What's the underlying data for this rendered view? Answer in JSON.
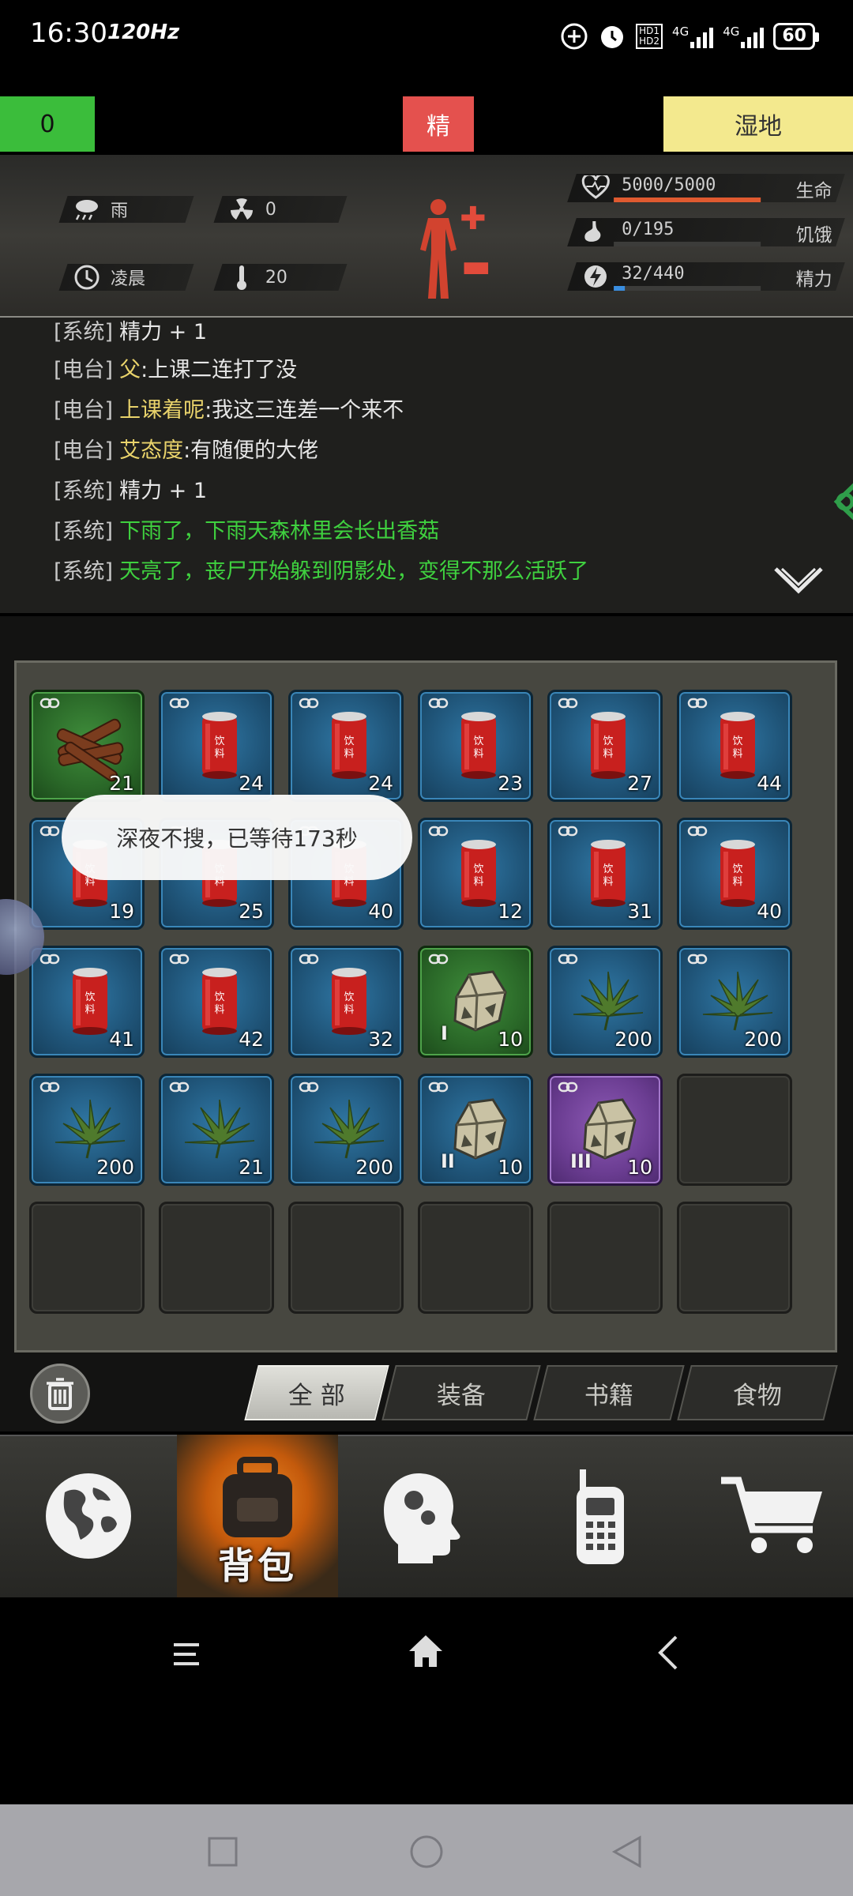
{
  "status_bar": {
    "time": "16:30",
    "refresh": "120Hz",
    "net1": "4G",
    "net2": "4G",
    "battery": "60",
    "hd_badge": "HD1 HD2"
  },
  "markers": {
    "left_value": "0",
    "middle": "精",
    "right": "湿地"
  },
  "hud": {
    "weather": {
      "icon": "rain-cloud-icon",
      "label": "雨"
    },
    "radiation": {
      "icon": "radiation-icon",
      "value": "0"
    },
    "time_of_day": {
      "icon": "clock-icon",
      "label": "凌晨"
    },
    "temperature": {
      "icon": "thermometer-icon",
      "value": "20"
    },
    "stats": [
      {
        "label": "生命",
        "value": "5000/5000",
        "fraction": 1.0,
        "color": "#e05a30",
        "icon": "heart-icon"
      },
      {
        "label": "饥饿",
        "value": "0/195",
        "fraction": 0.0,
        "color": "#888888",
        "icon": "stomach-icon"
      },
      {
        "label": "精力",
        "value": "32/440",
        "fraction": 0.073,
        "color": "#3a8ee0",
        "icon": "lightning-icon"
      }
    ]
  },
  "log": [
    {
      "tag": "[系统]",
      "speaker": "",
      "text": "精力 + 1",
      "color": "white"
    },
    {
      "tag": "[电台]",
      "speaker": "父",
      "text": ":上课二连打了没",
      "color": "yellow"
    },
    {
      "tag": "[电台]",
      "speaker": "上课着呢",
      "text": ":我这三连差一个来不",
      "color": "yellow"
    },
    {
      "tag": "[电台]",
      "speaker": "艾态度",
      "text": ":有随便的大佬",
      "color": "yellow"
    },
    {
      "tag": "[系统]",
      "speaker": "",
      "text": "精力 + 1",
      "color": "white"
    },
    {
      "tag": "[系统]",
      "speaker": "",
      "text": "下雨了，下雨天森林里会长出香菇",
      "color": "green"
    },
    {
      "tag": "[系统]",
      "speaker": "",
      "text": "天亮了，丧尸开始躲到阴影处，变得不那么活跃了",
      "color": "green"
    }
  ],
  "toast": "深夜不搜，已等待173秒",
  "inventory": [
    [
      {
        "item": "wood",
        "rarity": "green",
        "count": "21"
      },
      {
        "item": "drink",
        "rarity": "blue",
        "count": "24"
      },
      {
        "item": "drink",
        "rarity": "blue",
        "count": "24"
      },
      {
        "item": "drink",
        "rarity": "blue",
        "count": "23"
      },
      {
        "item": "drink",
        "rarity": "blue",
        "count": "27"
      },
      {
        "item": "drink",
        "rarity": "blue",
        "count": "44"
      }
    ],
    [
      {
        "item": "drink",
        "rarity": "blue",
        "count": "19"
      },
      {
        "item": "drink",
        "rarity": "blue",
        "count": "25"
      },
      {
        "item": "drink",
        "rarity": "blue",
        "count": "40"
      },
      {
        "item": "drink",
        "rarity": "blue",
        "count": "12"
      },
      {
        "item": "drink",
        "rarity": "blue",
        "count": "31"
      },
      {
        "item": "drink",
        "rarity": "blue",
        "count": "40"
      }
    ],
    [
      {
        "item": "drink",
        "rarity": "blue",
        "count": "41"
      },
      {
        "item": "drink",
        "rarity": "blue",
        "count": "42"
      },
      {
        "item": "drink",
        "rarity": "blue",
        "count": "32"
      },
      {
        "item": "ore",
        "rarity": "green",
        "count": "10",
        "tier": "I"
      },
      {
        "item": "herb",
        "rarity": "blue",
        "count": "200"
      },
      {
        "item": "herb",
        "rarity": "blue",
        "count": "200"
      }
    ],
    [
      {
        "item": "herb",
        "rarity": "blue",
        "count": "200"
      },
      {
        "item": "herb",
        "rarity": "blue",
        "count": "21"
      },
      {
        "item": "herb",
        "rarity": "blue",
        "count": "200"
      },
      {
        "item": "ore",
        "rarity": "blue",
        "count": "10",
        "tier": "II"
      },
      {
        "item": "ore",
        "rarity": "purple",
        "count": "10",
        "tier": "III"
      },
      {
        "item": "empty",
        "rarity": "empty",
        "count": ""
      }
    ],
    [
      {
        "item": "empty",
        "rarity": "empty",
        "count": ""
      },
      {
        "item": "empty",
        "rarity": "empty",
        "count": ""
      },
      {
        "item": "empty",
        "rarity": "empty",
        "count": ""
      },
      {
        "item": "empty",
        "rarity": "empty",
        "count": ""
      },
      {
        "item": "empty",
        "rarity": "empty",
        "count": ""
      },
      {
        "item": "empty",
        "rarity": "empty",
        "count": ""
      }
    ]
  ],
  "drink_label": "饮料",
  "tabs": [
    {
      "label": "全 部",
      "active": true
    },
    {
      "label": "装备",
      "active": false
    },
    {
      "label": "书籍",
      "active": false
    },
    {
      "label": "食物",
      "active": false
    }
  ],
  "bottom_nav": [
    {
      "icon": "globe-icon",
      "label": ""
    },
    {
      "icon": "backpack-icon",
      "label": "背包",
      "active": true
    },
    {
      "icon": "brain-head-icon",
      "label": ""
    },
    {
      "icon": "radio-icon",
      "label": ""
    },
    {
      "icon": "shopping-cart-icon",
      "label": ""
    }
  ]
}
